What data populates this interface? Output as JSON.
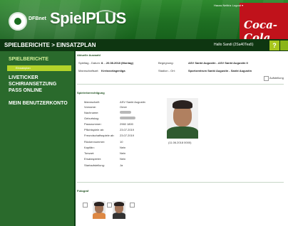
{
  "header": {
    "dfb_label": "DFBnet",
    "brand": "SpielPLUS",
    "sponsor": "Coca-Cola",
    "top_user": "Hauss Nelbi ▸ Logout ▾"
  },
  "navbar": {
    "breadcrumb": "SPIELBERICHTE > EINSATZPLAN",
    "user": "Hallo Sandi (2Sa40Tea5)",
    "help_label": "?"
  },
  "sidebar": {
    "heading": "SPIELBERICHTE",
    "active_item": "Einsatzplan",
    "items": [
      "LIVETICKER",
      "SCHIRIANSETZUNG",
      "PASS ONLINE",
      "MEIN BENUTZERKONTO"
    ]
  },
  "match": {
    "section_title": "Aktuelle Auswahl",
    "datum_label": "Spieltag - Datum:",
    "datum_value": "8. - 20.08.2018 (Montag)",
    "begegnung_label": "Begegnung:",
    "begegnung_value": "ASV Sankt Augustin - ASV Sankt Augustin II",
    "spielklasse_label": "Mannschaftsart:",
    "spielklasse_value": "Kreisvorlagenliga",
    "stadion_label": "Stadion - Ort:",
    "stadion_value": "Sportzentrum Sankt Augustin - Sankt Augustin",
    "aufstellung_label": "Aufstellung"
  },
  "spieler": {
    "section_title": "Spielerberechtigung",
    "fields": [
      {
        "label": "Mannschaft:",
        "value": "ASV Sankt Augustin"
      },
      {
        "label": "Vorname:",
        "value": "Omer"
      },
      {
        "label": "Nachname:",
        "value": ""
      },
      {
        "label": "Geburtstag:",
        "value": ""
      },
      {
        "label": "Passnummer:",
        "value": "2960 1800"
      },
      {
        "label": "Pflichtspiele ab:",
        "value": "23.07.2019"
      },
      {
        "label": "Freundschaftsspiele ab:",
        "value": "23.07.2019"
      },
      {
        "label": "Rückennummer:",
        "value": "10"
      },
      {
        "label": "Kapitän:",
        "value": "Nein"
      },
      {
        "label": "Torwart:",
        "value": "Nein"
      },
      {
        "label": "Ersatzspieler:",
        "value": "Nein"
      },
      {
        "label": "Startaufstellung:",
        "value": "Ja"
      }
    ],
    "photo_caption": "(11.06.2018 0000)"
  },
  "fotograf": {
    "section_title": "Fotograf"
  }
}
